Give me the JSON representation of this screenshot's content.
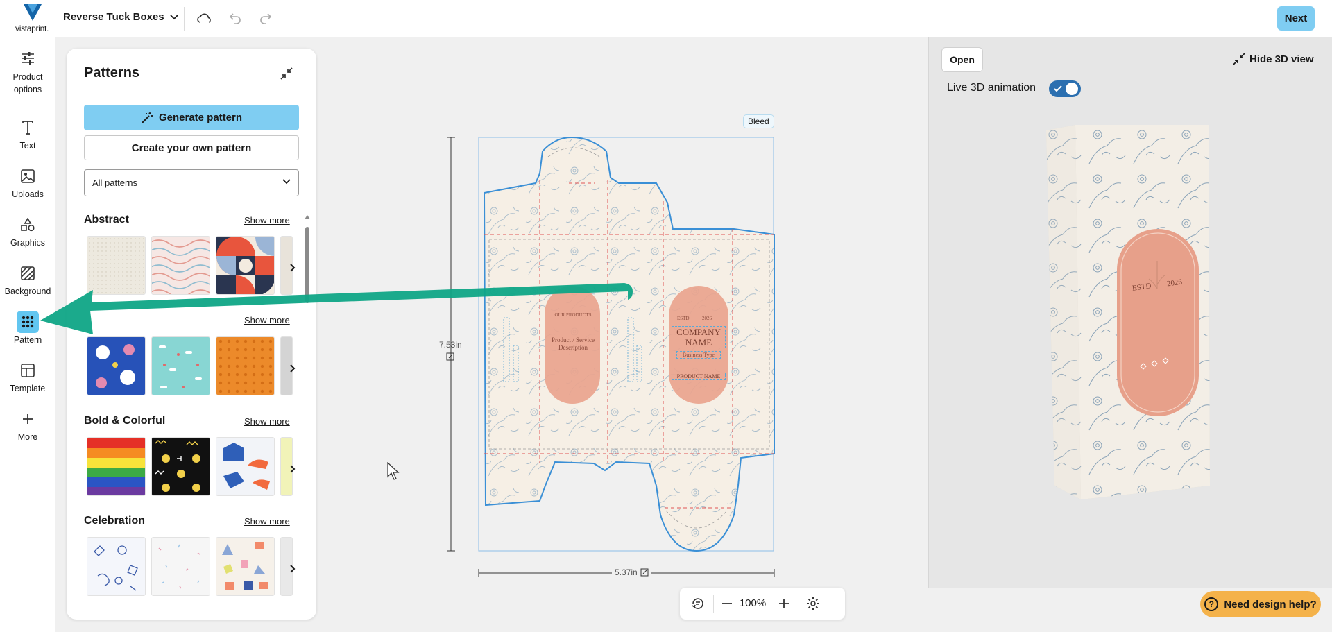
{
  "header": {
    "logo_text": "vistaprint.",
    "product_title": "Reverse Tuck Boxes",
    "next_label": "Next"
  },
  "rail": {
    "items": [
      {
        "label": "Product options",
        "icon": "sliders-icon"
      },
      {
        "label": "Text",
        "icon": "text-icon"
      },
      {
        "label": "Uploads",
        "icon": "image-upload-icon"
      },
      {
        "label": "Graphics",
        "icon": "shapes-icon"
      },
      {
        "label": "Background",
        "icon": "hatch-icon"
      },
      {
        "label": "Pattern",
        "icon": "grid-dots-icon",
        "active": true
      },
      {
        "label": "Template",
        "icon": "layout-icon"
      },
      {
        "label": "More",
        "icon": "plus-icon"
      }
    ]
  },
  "panel": {
    "title": "Patterns",
    "generate_label": "Generate pattern",
    "create_label": "Create your own pattern",
    "filter_value": "All patterns",
    "show_more": "Show more",
    "sections": [
      {
        "title": "Abstract"
      },
      {
        "title": ""
      },
      {
        "title": "Bold & Colorful"
      },
      {
        "title": "Celebration"
      }
    ]
  },
  "canvas": {
    "bleed_label": "Bleed",
    "height_label": "7.53in",
    "width_label": "5.37in",
    "box_text": {
      "our_products": "OUR PRODUCTS",
      "service_desc_1": "Product / Service",
      "service_desc_2": "Description",
      "estd": "ESTD",
      "year": "2026",
      "company_1": "COMPANY",
      "company_2": "NAME",
      "business_type": "Business Type",
      "product_name": "PRODUCT NAME"
    }
  },
  "zoom": {
    "value": "100%"
  },
  "preview": {
    "open_label": "Open",
    "hide_label": "Hide 3D view",
    "live_label": "Live 3D animation",
    "estd": "ESTD",
    "year": "2026"
  },
  "help": {
    "label": "Need design help?"
  },
  "colors": {
    "accent": "#7fcdf2",
    "pattern_active": "#62c6f0",
    "arrow": "#0fa586",
    "dieline": "#3a8fd6",
    "box_bg": "#f6efe5",
    "label_salmon": "#e9a48e",
    "help": "#f4b24a"
  }
}
